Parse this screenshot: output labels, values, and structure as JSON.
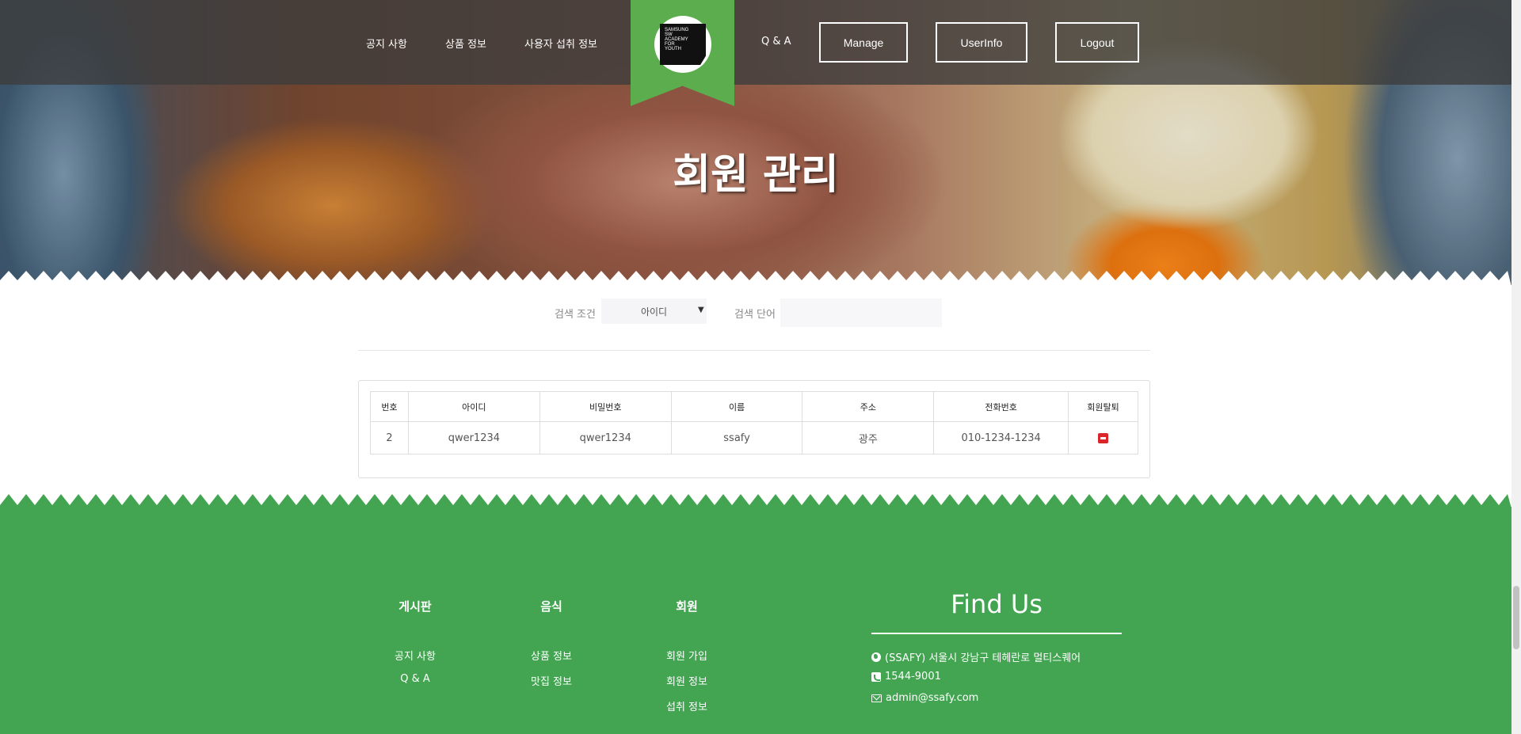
{
  "nav": {
    "notice": "공지 사항",
    "product": "상품 정보",
    "intake": "사용자 섭취 정보",
    "qna": "Q & A",
    "manage": "Manage",
    "userinfo": "UserInfo",
    "logout": "Logout"
  },
  "logo": {
    "lines": [
      "SAMSUNG",
      "SW",
      "ACADEMY",
      "FOR",
      "YOUTH"
    ]
  },
  "hero": {
    "title": "회원 관리"
  },
  "search": {
    "condition_label": "검색 조건",
    "condition_value": "아이디",
    "keyword_label": "검색 단어",
    "keyword_value": ""
  },
  "table": {
    "headers": [
      "번호",
      "아이디",
      "비밀번호",
      "이름",
      "주소",
      "전화번호",
      "회원탈퇴"
    ],
    "rows": [
      {
        "no": "2",
        "id": "qwer1234",
        "password": "qwer1234",
        "name": "ssafy",
        "address": "광주",
        "phone": "010-1234-1234"
      }
    ]
  },
  "footer": {
    "board": {
      "title": "게시판",
      "links": [
        "공지 사항",
        "Q & A"
      ]
    },
    "food": {
      "title": "음식",
      "links": [
        "상품 정보",
        "맛집 정보"
      ]
    },
    "member": {
      "title": "회원",
      "links": [
        "회원 가입",
        "회원 정보",
        "섭취 정보"
      ]
    },
    "find_us": {
      "title": "Find Us",
      "address": "(SSAFY) 서울시 강남구 테헤란로 멀티스퀘어",
      "phone": "1544-9001",
      "email": "admin@ssafy.com"
    }
  },
  "colors": {
    "brand_green": "#43a551",
    "ribbon_green": "#5cad4e",
    "delete_red": "#d9262b"
  }
}
